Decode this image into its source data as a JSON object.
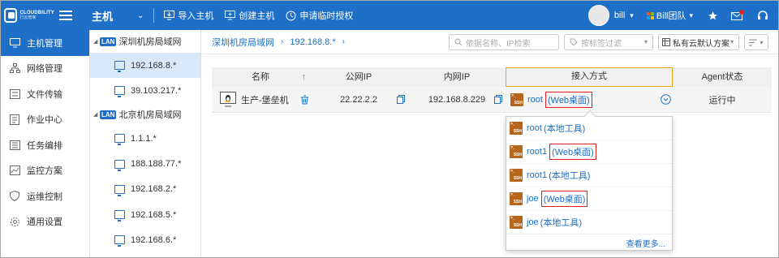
{
  "brand": {
    "name": "CLOUDBILITY",
    "subname": "行云管家"
  },
  "header": {
    "module_title": "主机",
    "buttons": [
      {
        "label": "导入主机",
        "icon": "import-icon"
      },
      {
        "label": "创建主机",
        "icon": "create-icon"
      },
      {
        "label": "申请临时授权",
        "icon": "clock-icon"
      }
    ],
    "user": "bill",
    "team": "Bill团队"
  },
  "sidebar": {
    "items": [
      {
        "label": "主机管理",
        "icon": "monitor-icon",
        "active": true
      },
      {
        "label": "网络管理",
        "icon": "network-icon"
      },
      {
        "label": "文件传输",
        "icon": "file-transfer-icon"
      },
      {
        "label": "作业中心",
        "icon": "job-icon"
      },
      {
        "label": "任务编排",
        "icon": "task-icon"
      },
      {
        "label": "监控方案",
        "icon": "monitor-chart-icon"
      },
      {
        "label": "运维控制",
        "icon": "shield-icon"
      },
      {
        "label": "通用设置",
        "icon": "gear-icon"
      }
    ]
  },
  "tree": {
    "groups": [
      {
        "tag": "LAN",
        "name": "深圳机房局域网",
        "nodes": [
          "192.168.8.*",
          "39.103.217.*"
        ]
      },
      {
        "tag": "LAN",
        "name": "北京机房局域网",
        "nodes": [
          "1.1.1.*",
          "188.188.77.*",
          "192.168.2.*",
          "192.168.5.*",
          "192.168.6.*"
        ]
      }
    ]
  },
  "breadcrumb": [
    "深圳机房局域网",
    "192.168.8.*"
  ],
  "toolbar": {
    "search_placeholder": "依据名称、IP检索",
    "filter_placeholder": "按标签过滤",
    "scheme": "私有云默认方案"
  },
  "table": {
    "headers": {
      "name": "名称",
      "public_ip": "公网IP",
      "private_ip": "内网IP",
      "access": "接入方式",
      "agent": "Agent状态"
    },
    "rows": [
      {
        "name": "生产-堡垒机",
        "public_ip": "22.22.2.2",
        "private_ip": "192.168.8.229",
        "access_user": "root",
        "access_tool": "(Web桌面)",
        "agent": "运行中"
      }
    ]
  },
  "dropdown": {
    "items": [
      {
        "user": "root",
        "tool": "(本地工具)",
        "highlight": false
      },
      {
        "user": "root1",
        "tool": "(Web桌面)",
        "highlight": true
      },
      {
        "user": "root1",
        "tool": "(本地工具)",
        "highlight": false
      },
      {
        "user": "joe",
        "tool": "(Web桌面)",
        "highlight": true
      },
      {
        "user": "joe",
        "tool": "(本地工具)",
        "highlight": false
      }
    ],
    "more": "查看更多..."
  },
  "colors": {
    "brand": "#1d6fc8",
    "highlight_border": "#e02020",
    "header_focus": "#e8a317",
    "ssh_badge": "#b5651d"
  }
}
